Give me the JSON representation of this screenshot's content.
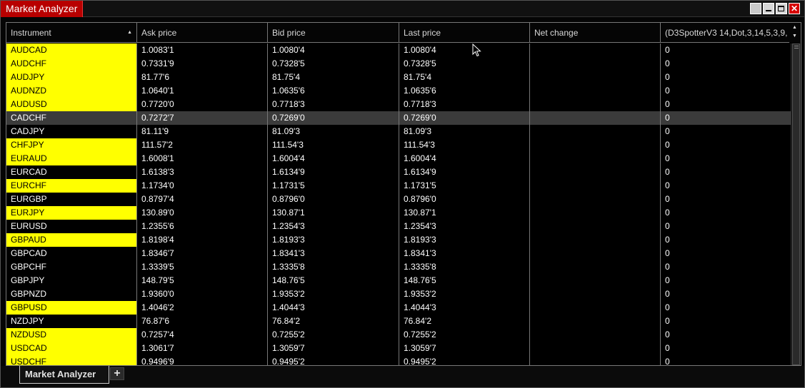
{
  "window": {
    "title": "Market Analyzer",
    "buttons": [
      {
        "name": "properties",
        "glyph": ""
      },
      {
        "name": "minimize",
        "glyph": ""
      },
      {
        "name": "restore",
        "glyph": ""
      },
      {
        "name": "close",
        "glyph": "✕"
      }
    ]
  },
  "grid": {
    "columns": [
      {
        "key": "instrument",
        "label": "Instrument"
      },
      {
        "key": "ask",
        "label": "Ask price"
      },
      {
        "key": "bid",
        "label": "Bid price"
      },
      {
        "key": "last",
        "label": "Last price"
      },
      {
        "key": "net",
        "label": "Net change"
      },
      {
        "key": "ind",
        "label": "(D3SpotterV3 14,Dot,3,14,5,3,9,"
      }
    ],
    "sort_indicator": "▲",
    "scroll_up": "▲",
    "scroll_down": "▼",
    "rows": [
      {
        "instrument": "AUDCAD",
        "ask": "1.0083'1",
        "bid": "1.0080'4",
        "last": "1.0080'4",
        "net": "",
        "ind": "0",
        "highlight": true
      },
      {
        "instrument": "AUDCHF",
        "ask": "0.7331'9",
        "bid": "0.7328'5",
        "last": "0.7328'5",
        "net": "",
        "ind": "0",
        "highlight": true
      },
      {
        "instrument": "AUDJPY",
        "ask": "81.77'6",
        "bid": "81.75'4",
        "last": "81.75'4",
        "net": "",
        "ind": "0",
        "highlight": true
      },
      {
        "instrument": "AUDNZD",
        "ask": "1.0640'1",
        "bid": "1.0635'6",
        "last": "1.0635'6",
        "net": "",
        "ind": "0",
        "highlight": true
      },
      {
        "instrument": "AUDUSD",
        "ask": "0.7720'0",
        "bid": "0.7718'3",
        "last": "0.7718'3",
        "net": "",
        "ind": "0",
        "highlight": true
      },
      {
        "instrument": "CADCHF",
        "ask": "0.7272'7",
        "bid": "0.7269'0",
        "last": "0.7269'0",
        "net": "",
        "ind": "0",
        "highlight": false,
        "selected": true
      },
      {
        "instrument": "CADJPY",
        "ask": "81.11'9",
        "bid": "81.09'3",
        "last": "81.09'3",
        "net": "",
        "ind": "0",
        "highlight": false
      },
      {
        "instrument": "CHFJPY",
        "ask": "111.57'2",
        "bid": "111.54'3",
        "last": "111.54'3",
        "net": "",
        "ind": "0",
        "highlight": true
      },
      {
        "instrument": "EURAUD",
        "ask": "1.6008'1",
        "bid": "1.6004'4",
        "last": "1.6004'4",
        "net": "",
        "ind": "0",
        "highlight": true
      },
      {
        "instrument": "EURCAD",
        "ask": "1.6138'3",
        "bid": "1.6134'9",
        "last": "1.6134'9",
        "net": "",
        "ind": "0",
        "highlight": false
      },
      {
        "instrument": "EURCHF",
        "ask": "1.1734'0",
        "bid": "1.1731'5",
        "last": "1.1731'5",
        "net": "",
        "ind": "0",
        "highlight": true
      },
      {
        "instrument": "EURGBP",
        "ask": "0.8797'4",
        "bid": "0.8796'0",
        "last": "0.8796'0",
        "net": "",
        "ind": "0",
        "highlight": false
      },
      {
        "instrument": "EURJPY",
        "ask": "130.89'0",
        "bid": "130.87'1",
        "last": "130.87'1",
        "net": "",
        "ind": "0",
        "highlight": true
      },
      {
        "instrument": "EURUSD",
        "ask": "1.2355'6",
        "bid": "1.2354'3",
        "last": "1.2354'3",
        "net": "",
        "ind": "0",
        "highlight": false
      },
      {
        "instrument": "GBPAUD",
        "ask": "1.8198'4",
        "bid": "1.8193'3",
        "last": "1.8193'3",
        "net": "",
        "ind": "0",
        "highlight": true
      },
      {
        "instrument": "GBPCAD",
        "ask": "1.8346'7",
        "bid": "1.8341'3",
        "last": "1.8341'3",
        "net": "",
        "ind": "0",
        "highlight": false
      },
      {
        "instrument": "GBPCHF",
        "ask": "1.3339'5",
        "bid": "1.3335'8",
        "last": "1.3335'8",
        "net": "",
        "ind": "0",
        "highlight": false
      },
      {
        "instrument": "GBPJPY",
        "ask": "148.79'5",
        "bid": "148.76'5",
        "last": "148.76'5",
        "net": "",
        "ind": "0",
        "highlight": false
      },
      {
        "instrument": "GBPNZD",
        "ask": "1.9360'0",
        "bid": "1.9353'2",
        "last": "1.9353'2",
        "net": "",
        "ind": "0",
        "highlight": false
      },
      {
        "instrument": "GBPUSD",
        "ask": "1.4046'2",
        "bid": "1.4044'3",
        "last": "1.4044'3",
        "net": "",
        "ind": "0",
        "highlight": true
      },
      {
        "instrument": "NZDJPY",
        "ask": "76.87'6",
        "bid": "76.84'2",
        "last": "76.84'2",
        "net": "",
        "ind": "0",
        "highlight": false
      },
      {
        "instrument": "NZDUSD",
        "ask": "0.7257'4",
        "bid": "0.7255'2",
        "last": "0.7255'2",
        "net": "",
        "ind": "0",
        "highlight": true
      },
      {
        "instrument": "USDCAD",
        "ask": "1.3061'7",
        "bid": "1.3059'7",
        "last": "1.3059'7",
        "net": "",
        "ind": "0",
        "highlight": true
      },
      {
        "instrument": "USDCHF",
        "ask": "0.9496'9",
        "bid": "0.9495'2",
        "last": "0.9495'2",
        "net": "",
        "ind": "0",
        "highlight": true
      }
    ]
  },
  "tabs": {
    "active_label": "Market Analyzer",
    "add_label": "+"
  },
  "colors": {
    "title_bg": "#b80000",
    "highlight": "#ffff00",
    "selected_row": "#3b3b3b",
    "grid_bg": "#000000"
  }
}
